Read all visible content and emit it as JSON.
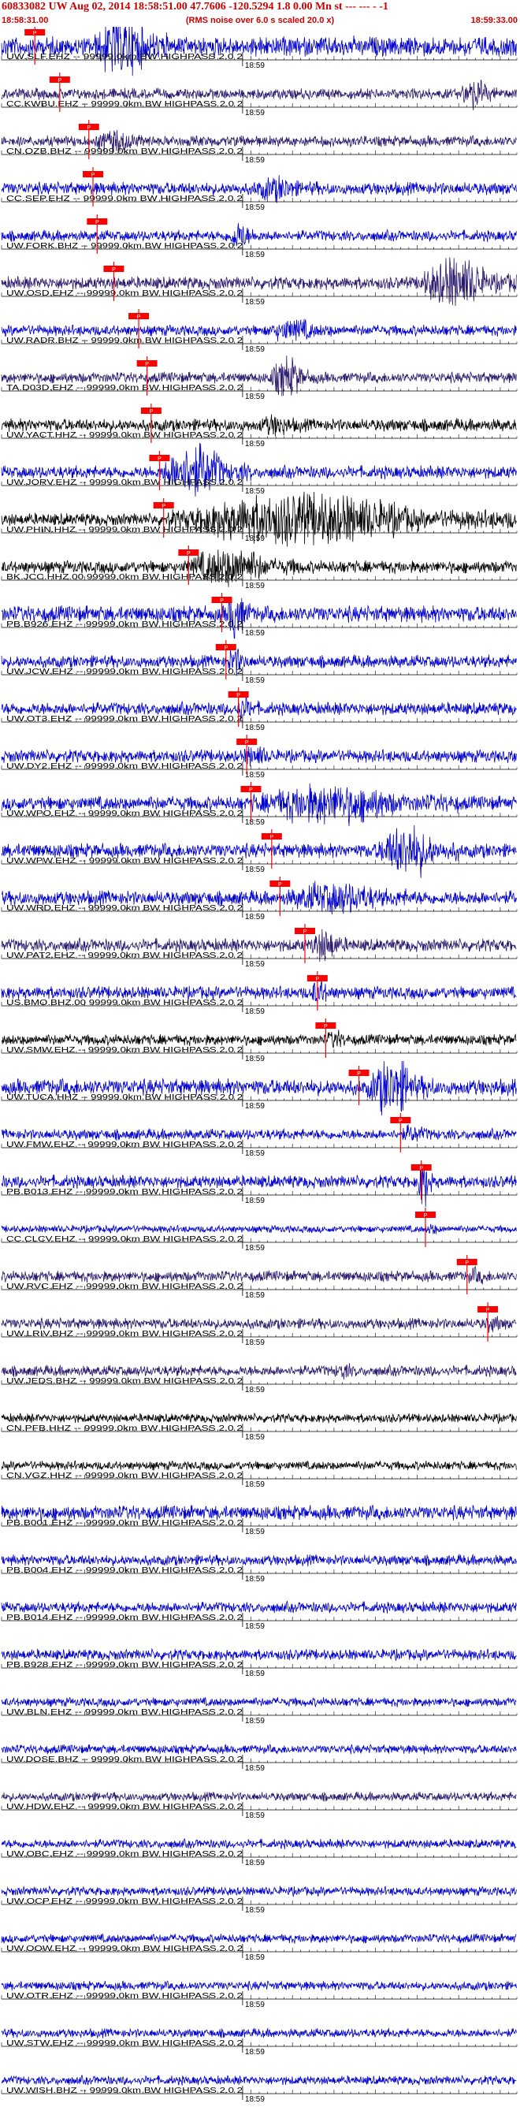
{
  "header": {
    "title": "60833082 UW Aug 02, 2014 18:58:51.00   47.7606 -120.5294  1.8 0.00 Mn st --- --- - -1",
    "start_time": "18:58:31.00",
    "rms_note": "(RMS noise over 6.0 s scaled 20.0 x)",
    "end_time": "18:59:33.00"
  },
  "chart_data": {
    "type": "line",
    "time_range": [
      "18:58:31.00",
      "18:59:33.00"
    ],
    "xlim": [
      0,
      62
    ],
    "minute_marker": {
      "label": "18:59",
      "seconds": 29
    },
    "pick_label": "P",
    "colors": {
      "title": "#cc0000",
      "pick": "#ff0000",
      "axis": "#000000",
      "trace_blue": "#0000cc",
      "trace_navy": "#2a1a6e",
      "trace_black": "#000000"
    },
    "traces": [
      {
        "label": "UW.SLF.EHZ -- 99999.0km BW HIGHPASS 2.0 2",
        "color": "#0000cc",
        "pick_s": 4.0,
        "amplitude": 0.55,
        "burst_s": [
          11,
          20
        ],
        "burst_gain": 3.5
      },
      {
        "label": "CC.KWBU.EHZ -- 99999.0km BW HIGHPASS 2.0 2",
        "color": "#2a1a6e",
        "pick_s": 7.0,
        "amplitude": 0.3,
        "burst_s": [
          55,
          60
        ],
        "burst_gain": 3.0
      },
      {
        "label": "CN.OZB.BHZ -- 99999.0km BW HIGHPASS 2.0 2",
        "color": "#2a1a6e",
        "pick_s": 10.5,
        "amplitude": 0.3,
        "burst_s": [
          11,
          18
        ],
        "burst_gain": 2.5
      },
      {
        "label": "CC.SEP.EHZ -- 99999.0km BW HIGHPASS 2.0 2",
        "color": "#0000cc",
        "pick_s": 11.0,
        "amplitude": 0.35,
        "burst_s": [
          30,
          38
        ],
        "burst_gain": 2.2
      },
      {
        "label": "UW.FORK.BHZ -- 99999.0km BW HIGHPASS 2.0 2",
        "color": "#0000cc",
        "pick_s": 11.5,
        "amplitude": 0.3,
        "burst_s": [
          27,
          31
        ],
        "burst_gain": 3.0
      },
      {
        "label": "UW.OSD.EHZ -- 99999.0km BW HIGHPASS 2.0 2",
        "color": "#2a1a6e",
        "pick_s": 13.5,
        "amplitude": 0.35,
        "burst_s": [
          50,
          62
        ],
        "burst_gain": 4.5
      },
      {
        "label": "UW.RADR.BHZ -- 99999.0km BW HIGHPASS 2.0 2",
        "color": "#0000cc",
        "pick_s": 16.5,
        "amplitude": 0.3,
        "burst_s": [
          32,
          40
        ],
        "burst_gain": 2.5
      },
      {
        "label": "TA.D03D.EHZ -- 99999.0km BW HIGHPASS 2.0 2",
        "color": "#2a1a6e",
        "pick_s": 17.5,
        "amplitude": 0.3,
        "burst_s": [
          32,
          38
        ],
        "burst_gain": 4.0
      },
      {
        "label": "UW.YACT.HHZ -- 99999.0km BW HIGHPASS 2.0 2",
        "color": "#000000",
        "pick_s": 18.0,
        "amplitude": 0.35,
        "burst_s": [
          31,
          36
        ],
        "burst_gain": 2.0
      },
      {
        "label": "UW.JORV.EHZ -- 99999.0km BW HIGHPASS 2.0 2",
        "color": "#0000cc",
        "pick_s": 19.0,
        "amplitude": 0.35,
        "burst_s": [
          19,
          30
        ],
        "burst_gain": 5.0
      },
      {
        "label": "UW.PHIN.HHZ -- 99999.0km BW HIGHPASS 2.0 2",
        "color": "#000000",
        "pick_s": 19.5,
        "amplitude": 0.35,
        "burst_s": [
          20,
          62
        ],
        "burst_gain": 4.5
      },
      {
        "label": "BK.JCC.HHZ.00 99999.0km BW HIGHPASS 2.0 2",
        "color": "#000000",
        "pick_s": 22.5,
        "amplitude": 0.35,
        "burst_s": [
          22,
          36
        ],
        "burst_gain": 3.5
      },
      {
        "label": "PB.B926.EHZ -- 99999.0km BW HIGHPASS 2.0 2",
        "color": "#0000cc",
        "pick_s": 26.5,
        "amplitude": 0.45,
        "burst_s": [
          27,
          30
        ],
        "burst_gain": 4.0
      },
      {
        "label": "UW.JCW.EHZ -- 99999.0km BW HIGHPASS 2.0 2",
        "color": "#0000cc",
        "pick_s": 27.0,
        "amplitude": 0.35,
        "burst_s": [
          27,
          30
        ],
        "burst_gain": 2.5
      },
      {
        "label": "UW.OT3.EHZ -- 99999.0km BW HIGHPASS 2.0 2",
        "color": "#0000cc",
        "pick_s": 28.5,
        "amplitude": 0.35,
        "burst_s": [
          28,
          31
        ],
        "burst_gain": 2.5
      },
      {
        "label": "UW.DY2.EHZ -- 99999.0km BW HIGHPASS 2.0 2",
        "color": "#0000cc",
        "pick_s": 29.5,
        "amplitude": 0.35,
        "burst_s": [
          29,
          33
        ],
        "burst_gain": 2.0
      },
      {
        "label": "UW.WPO.EHZ -- 99999.0km BW HIGHPASS 2.0 2",
        "color": "#0000cc",
        "pick_s": 30.0,
        "amplitude": 0.4,
        "burst_s": [
          30,
          55
        ],
        "burst_gain": 3.0
      },
      {
        "label": "UW.WPW.EHZ -- 99999.0km BW HIGHPASS 2.0 2",
        "color": "#0000cc",
        "pick_s": 32.5,
        "amplitude": 0.4,
        "burst_s": [
          45,
          55
        ],
        "burst_gain": 4.0
      },
      {
        "label": "UW.WRD.EHZ -- 99999.0km BW HIGHPASS 2.0 2",
        "color": "#0000cc",
        "pick_s": 33.5,
        "amplitude": 0.4,
        "burst_s": [
          34,
          50
        ],
        "burst_gain": 2.5
      },
      {
        "label": "UW.PAT2.EHZ -- 99999.0km BW HIGHPASS 2.0 2",
        "color": "#2a1a6e",
        "pick_s": 36.5,
        "amplitude": 0.35,
        "burst_s": [
          37,
          42
        ],
        "burst_gain": 3.0
      },
      {
        "label": "US.BMO.BHZ.00 99999.0km BW HIGHPASS 2.0 2",
        "color": "#0000cc",
        "pick_s": 38.0,
        "amplitude": 0.35,
        "burst_s": [
          37,
          40
        ],
        "burst_gain": 2.5
      },
      {
        "label": "UW.SMW.EHZ -- 99999.0km BW HIGHPASS 2.0 2",
        "color": "#000000",
        "pick_s": 39.0,
        "amplitude": 0.3,
        "burst_s": [
          39,
          42
        ],
        "burst_gain": 2.0
      },
      {
        "label": "UW.TUCA.HHZ -- 99999.0km BW HIGHPASS 2.0 2",
        "color": "#0000cc",
        "pick_s": 43.0,
        "amplitude": 0.45,
        "burst_s": [
          44,
          52
        ],
        "burst_gain": 4.0
      },
      {
        "label": "UW.FMW.EHZ -- 99999.0km BW HIGHPASS 2.0 2",
        "color": "#0000cc",
        "pick_s": 48.0,
        "amplitude": 0.3,
        "burst_s": [
          48,
          52
        ],
        "burst_gain": 2.0
      },
      {
        "label": "PB.B013.EHZ -- 99999.0km BW HIGHPASS 2.0 2",
        "color": "#0000cc",
        "pick_s": 50.5,
        "amplitude": 0.35,
        "burst_s": [
          50,
          52
        ],
        "burst_gain": 4.5
      },
      {
        "label": "CC.CLCV.EHZ -- 99999.0km BW HIGHPASS 2.0 2",
        "color": "#0000cc",
        "pick_s": 51.0,
        "amplitude": 0.2,
        "burst_s": [
          51,
          53
        ],
        "burst_gain": 2.0
      },
      {
        "label": "UW.RVC.EHZ -- 99999.0km BW HIGHPASS 2.0 2",
        "color": "#2a1a6e",
        "pick_s": 56.0,
        "amplitude": 0.3,
        "burst_s": [
          56,
          59
        ],
        "burst_gain": 1.8
      },
      {
        "label": "UW.LRIV.BHZ -- 99999.0km BW HIGHPASS 2.0 2",
        "color": "#2a1a6e",
        "pick_s": 58.5,
        "amplitude": 0.3,
        "burst_s": [
          58,
          61
        ],
        "burst_gain": 1.8
      },
      {
        "label": "UW.JEDS.BHZ -- 99999.0km BW HIGHPASS 2.0 2",
        "color": "#2a1a6e",
        "pick_s": null,
        "amplitude": 0.3,
        "burst_s": [
          40,
          43
        ],
        "burst_gain": 1.8
      },
      {
        "label": "CN.PFB.HHZ -- 99999.0km BW HIGHPASS 2.0 2",
        "color": "#000000",
        "pick_s": null,
        "amplitude": 0.25,
        "burst_s": [
          5,
          6
        ],
        "burst_gain": 1.0
      },
      {
        "label": "CN.VGZ.HHZ -- 99999.0km BW HIGHPASS 2.0 2",
        "color": "#000000",
        "pick_s": null,
        "amplitude": 0.25,
        "burst_s": [
          5,
          6
        ],
        "burst_gain": 1.0
      },
      {
        "label": "PB.B001.EHZ -- 99999.0km BW HIGHPASS 2.0 2",
        "color": "#0000cc",
        "pick_s": null,
        "amplitude": 0.4,
        "burst_s": [
          5,
          6
        ],
        "burst_gain": 1.0
      },
      {
        "label": "PB.B004.EHZ -- 99999.0km BW HIGHPASS 2.0 2",
        "color": "#0000cc",
        "pick_s": null,
        "amplitude": 0.3,
        "burst_s": [
          5,
          6
        ],
        "burst_gain": 1.0
      },
      {
        "label": "PB.B014.EHZ -- 99999.0km BW HIGHPASS 2.0 2",
        "color": "#0000cc",
        "pick_s": null,
        "amplitude": 0.3,
        "burst_s": [
          5,
          6
        ],
        "burst_gain": 1.0
      },
      {
        "label": "PB.B928.EHZ -- 99999.0km BW HIGHPASS 2.0 2",
        "color": "#0000cc",
        "pick_s": null,
        "amplitude": 0.3,
        "burst_s": [
          5,
          6
        ],
        "burst_gain": 1.0
      },
      {
        "label": "UW.BLN.EHZ -- 99999.0km BW HIGHPASS 2.0 2",
        "color": "#0000cc",
        "pick_s": null,
        "amplitude": 0.25,
        "burst_s": [
          5,
          6
        ],
        "burst_gain": 1.0
      },
      {
        "label": "UW.DOSE.BHZ -- 99999.0km BW HIGHPASS 2.0 2",
        "color": "#0000cc",
        "pick_s": null,
        "amplitude": 0.25,
        "burst_s": [
          5,
          6
        ],
        "burst_gain": 1.0
      },
      {
        "label": "UW.HDW.EHZ -- 99999.0km BW HIGHPASS 2.0 2",
        "color": "#2a1a6e",
        "pick_s": null,
        "amplitude": 0.25,
        "burst_s": [
          5,
          6
        ],
        "burst_gain": 1.0
      },
      {
        "label": "UW.OBC.EHZ -- 99999.0km BW HIGHPASS 2.0 2",
        "color": "#0000cc",
        "pick_s": null,
        "amplitude": 0.25,
        "burst_s": [
          5,
          6
        ],
        "burst_gain": 1.0
      },
      {
        "label": "UW.OCP.EHZ -- 99999.0km BW HIGHPASS 2.0 2",
        "color": "#0000cc",
        "pick_s": null,
        "amplitude": 0.25,
        "burst_s": [
          5,
          6
        ],
        "burst_gain": 1.0
      },
      {
        "label": "UW.OOW.EHZ -- 99999.0km BW HIGHPASS 2.0 2",
        "color": "#0000cc",
        "pick_s": null,
        "amplitude": 0.25,
        "burst_s": [
          5,
          6
        ],
        "burst_gain": 1.0
      },
      {
        "label": "UW.OTR.EHZ -- 99999.0km BW HIGHPASS 2.0 2",
        "color": "#0000cc",
        "pick_s": null,
        "amplitude": 0.25,
        "burst_s": [
          5,
          6
        ],
        "burst_gain": 1.0
      },
      {
        "label": "UW.STW.EHZ -- 99999.0km BW HIGHPASS 2.0 2",
        "color": "#0000cc",
        "pick_s": null,
        "amplitude": 0.25,
        "burst_s": [
          5,
          6
        ],
        "burst_gain": 1.0
      },
      {
        "label": "UW.WISH.BHZ -- 99999.0km BW HIGHPASS 2.0 2",
        "color": "#0000cc",
        "pick_s": null,
        "amplitude": 0.25,
        "burst_s": [
          5,
          6
        ],
        "burst_gain": 1.0
      }
    ]
  }
}
